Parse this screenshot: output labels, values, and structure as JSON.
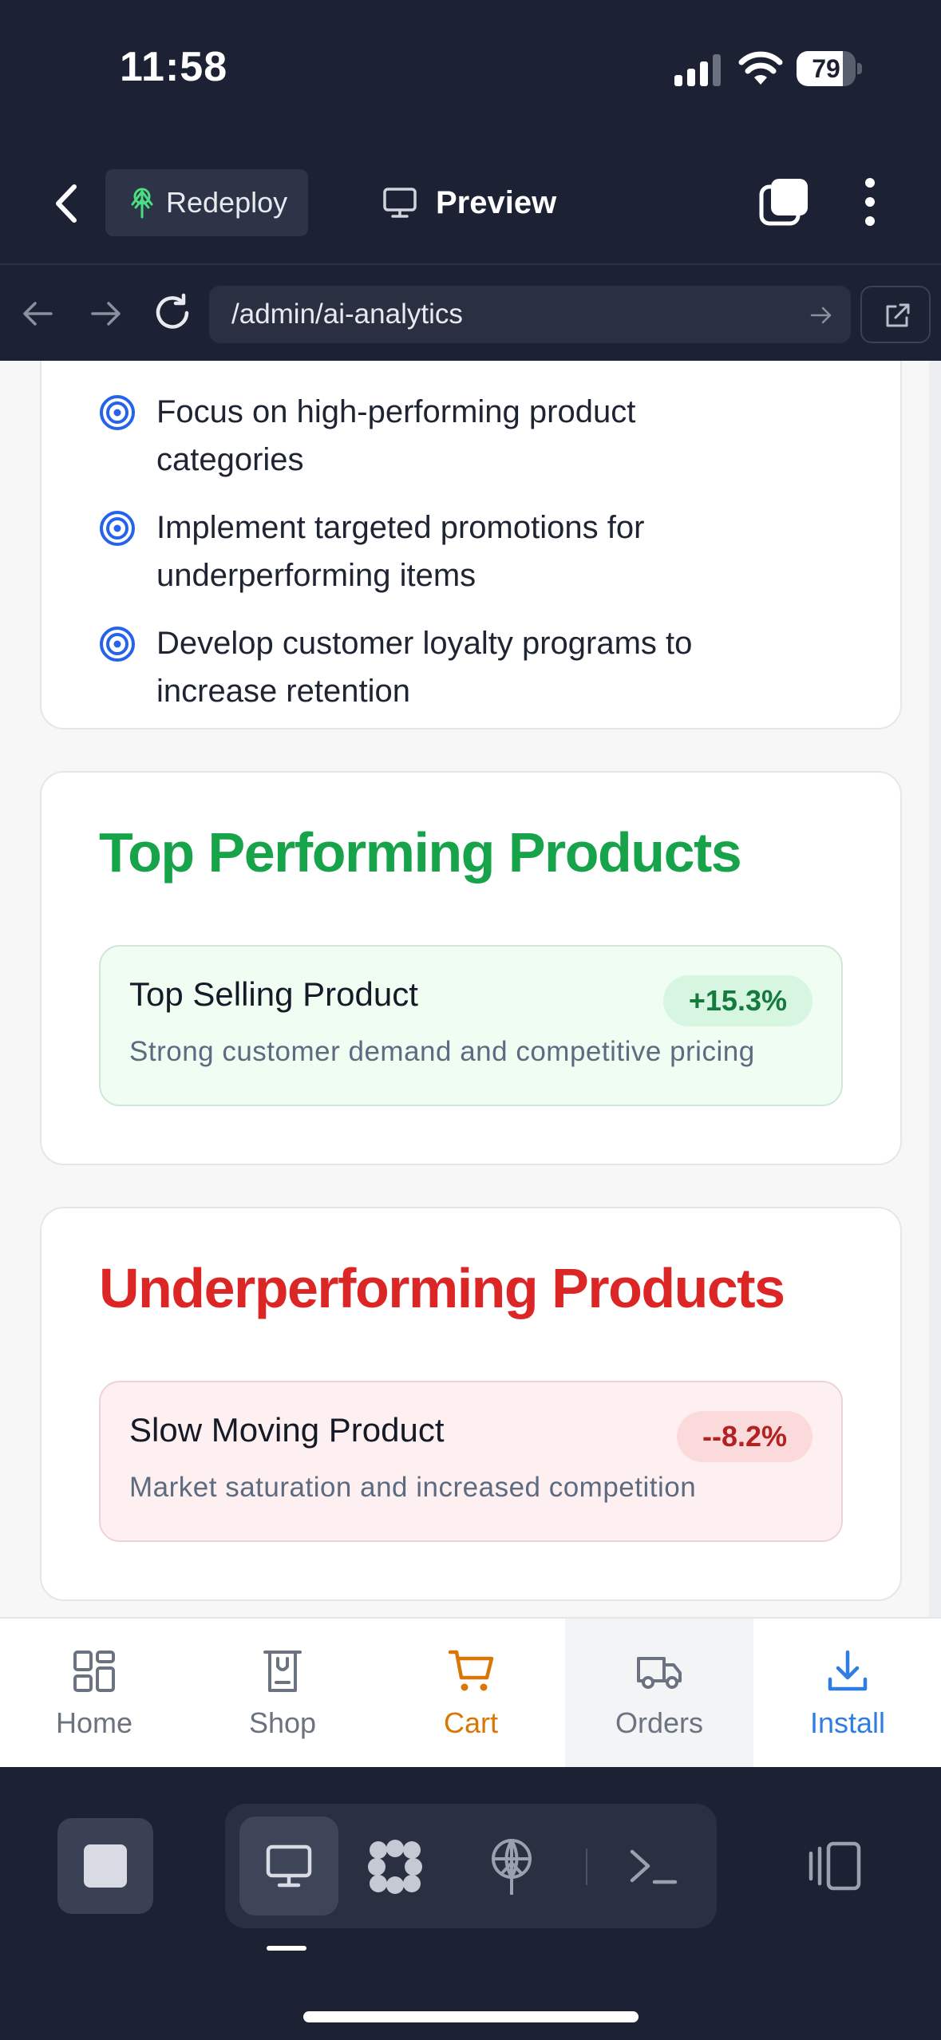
{
  "status": {
    "time": "11:58",
    "battery": "79",
    "battery_fraction": 0.79
  },
  "app_bar": {
    "redeploy_label": "Redeploy",
    "preview_label": "Preview"
  },
  "url_bar": {
    "path": "/admin/ai-analytics"
  },
  "recommendations": [
    {
      "line1": "Focus on high-performing product",
      "line2": "categories"
    },
    {
      "line1": "Implement targeted promotions for",
      "line2": "underperforming items"
    },
    {
      "line1": "Develop customer loyalty programs to",
      "line2": "increase retention"
    }
  ],
  "top_performing": {
    "title": "Top Performing Products",
    "product": "Top Selling Product",
    "change": "+15.3%",
    "reason": "Strong customer demand and competitive pricing"
  },
  "underperforming": {
    "title": "Underperforming Products",
    "product": "Slow Moving Product",
    "change": "--8.2%",
    "reason": "Market saturation and increased competition"
  },
  "bottom_nav": {
    "home": "Home",
    "shop": "Shop",
    "cart": "Cart",
    "orders": "Orders",
    "install": "Install"
  },
  "colors": {
    "accent_green": "#16a34a",
    "accent_red": "#dc2626",
    "cart_orange": "#d97706",
    "install_blue": "#2f7de1",
    "target_blue": "#2563eb"
  }
}
